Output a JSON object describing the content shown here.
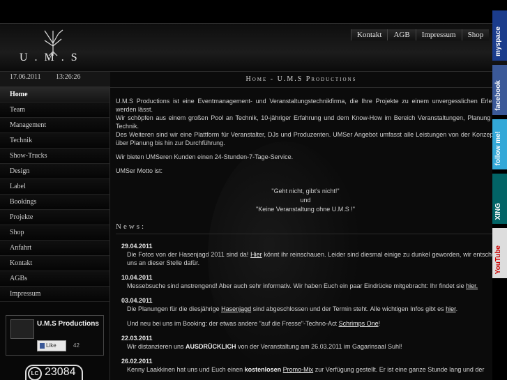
{
  "header": {
    "logo_text": "U.M.S"
  },
  "topnav": [
    "Kontakt",
    "AGB",
    "Impressum",
    "Shop"
  ],
  "datebar": {
    "date": "17.06.2011",
    "time": "13:26:26"
  },
  "sidebar": {
    "items": [
      "Home",
      "Team",
      "Management",
      "Technik",
      "Show-Trucks",
      "Design",
      "Label",
      "Bookings",
      "Projekte",
      "Shop",
      "Anfahrt",
      "Kontakt",
      "AGBs",
      "Impressum"
    ],
    "active": "Home"
  },
  "facebook": {
    "name": "U.M.S Productions",
    "like": "Like",
    "count": "42"
  },
  "counter": {
    "prefix": "LC",
    "number": "23084"
  },
  "main": {
    "title": "Home - U.M.S Productions",
    "intro": [
      "U.M.S Productions ist eine Eventmanagement- und Veranstaltungstechnikfirma, die Ihre Projekte zu einem unvergesslichen Erlebnis werden lässt.",
      "Wir schöpfen aus einem großen Pool an Technik, 10-jähriger Erfahrung und dem Know-How im Bereich Veranstaltungen, Planung und Technik.",
      "Des Weiteren sind wir eine Plattform für Veranstalter, DJs und Produzenten. UMSer Angebot umfasst alle Leistungen von der Konzeption über Planung bis hin zur Durchführung.",
      "Wir bieten UMSeren Kunden einen 24-Stunden-7-Tage-Service.",
      "UMSer Motto ist:"
    ],
    "motto": [
      "\"Geht nicht, gibt's nicht!\"",
      "und",
      "\"Keine Veranstaltung ohne U.M.S !\""
    ],
    "news_heading": "News:",
    "news": [
      {
        "date": "29.04.2011",
        "pre": "Die Fotos von der Hasenjagd 2011 sind da! ",
        "link": "Hier",
        "post": " könnt ihr reinschauen. Leider sind diesmal einige zu dunkel geworden, wir entschuldigen uns an dieser Stelle dafür."
      },
      {
        "date": "10.04.2011",
        "pre": "Messebsuche sind anstrengend! Aber auch sehr informativ. Wir haben Euch ein paar Eindrücke mitgebracht: Ihr findet sie ",
        "link": "hier.",
        "post": ""
      },
      {
        "date": "03.04.2011",
        "pre": "Die Planungen für die diesjährige ",
        "link": "Hasenjagd",
        "post": " sind abgeschlossen und der Termin steht. Alle wichtigen Infos gibt es ",
        "link2": "hier",
        "post2": "."
      },
      {
        "date": "",
        "pre": "Und neu bei uns im Booking: der etwas andere \"auf die Fresse\"-Techno-Act ",
        "link": "Schrimps One",
        "post": "!"
      },
      {
        "date": "22.03.2011",
        "pre": "Wir distanzieren uns ",
        "bold": "AUSDRÜCKLICH",
        "post": " von der Veranstaltung am 26.03.2011 im Gagarinsaal Suhl!"
      },
      {
        "date": "26.02.2011",
        "pre": "Kenny Laakkinen hat uns und Euch einen ",
        "bold": "kostenlosen",
        "link": "Promo-Mix",
        "post": " zur Verfügung gestellt. Er ist eine ganze Stunde lang und der"
      }
    ]
  },
  "social": [
    "myspace",
    "facebook",
    "follow me!",
    "XING",
    "YouTube"
  ]
}
